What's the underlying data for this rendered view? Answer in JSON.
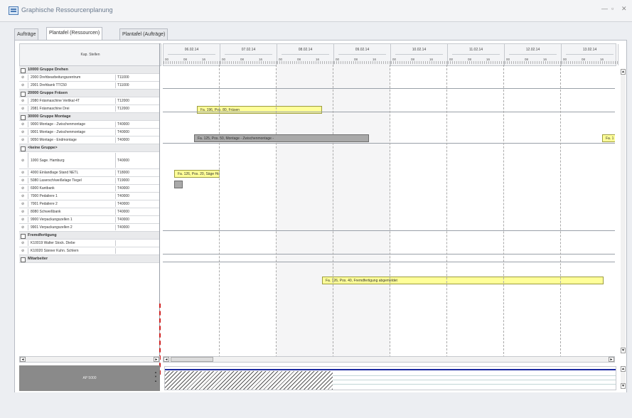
{
  "window": {
    "title": "Graphische Ressourcenplanung",
    "controls": [
      "—",
      "▫",
      "✕"
    ]
  },
  "tabs": [
    {
      "label": "Aufträge",
      "active": false
    },
    {
      "label": "Plantafel (Ressourcen)",
      "active": true
    },
    {
      "label": "Plantafel (Aufträge)",
      "active": false
    }
  ],
  "left_panel": {
    "header": "Kap. Stellen"
  },
  "groups": [
    {
      "label": "10000 Gruppe Drehen",
      "rows": [
        {
          "name": "2000 Drehbearbeitungszentrum",
          "code": "T11000"
        },
        {
          "name": "2001 Drehbank TTC50",
          "code": "T11000"
        }
      ]
    },
    {
      "label": "20000 Gruppe Fräsen",
      "rows": [
        {
          "name": "2080 Fräsmaschine Vertikal 4T",
          "code": "T12000"
        },
        {
          "name": "2081 Fräsmaschine Drei",
          "code": "T12000"
        }
      ]
    },
    {
      "label": "30000 Gruppe Montage",
      "rows": [
        {
          "name": "9000 Montage - Zwischenmontage",
          "code": "T40000"
        },
        {
          "name": "9001 Montage - Zwischenmontage",
          "code": "T40000"
        },
        {
          "name": "9050 Montage - Endmontage",
          "code": "T40000"
        }
      ]
    },
    {
      "label": "<keine Gruppe>",
      "rows": [
        {
          "name": "1000 Sage. Hamburg",
          "code": "T40000"
        },
        {
          "name": "4000 Einlandlage Stand NETL",
          "code": "T18000"
        },
        {
          "name": "5080 Lasersch/weißelage Tiegel",
          "code": "T19000"
        },
        {
          "name": "6900 Kantbank",
          "code": "T40000"
        },
        {
          "name": "7000 Pedaliere 1",
          "code": "T40000"
        },
        {
          "name": "7001 Pedaliere 2",
          "code": "T40000"
        },
        {
          "name": "8080 Schweißbank",
          "code": "T40000"
        },
        {
          "name": "9900 Verpackungszellen 1",
          "code": "T40000"
        },
        {
          "name": "9901 Verpackungszellen 2",
          "code": "T40000"
        }
      ]
    },
    {
      "label": "Fremdfertigung",
      "rows": [
        {
          "name": "K10019 Walter Stock. Diebe",
          "code": ""
        },
        {
          "name": "K10020 Sänner Kuhn. Schlern",
          "code": ""
        }
      ]
    },
    {
      "label": "Mitarbeiter",
      "rows": []
    }
  ],
  "timeline": {
    "days": [
      "06.02.14",
      "07.02.14",
      "08.02.14",
      "09.02.14",
      "10.02.14",
      "11.02.14",
      "12.02.14",
      "13.02.14"
    ],
    "hour_labels": [
      "00",
      "08",
      "16"
    ]
  },
  "bars": [
    {
      "label": "Fa. 196, Pos. 80, Fräsen",
      "color": "yellow"
    },
    {
      "label": "Fa. 125, Pos. 50, Montage - Zwischenmontage - ",
      "color": "gray"
    },
    {
      "label": "Fa. 1",
      "color": "yellow"
    },
    {
      "label": "Fa. 126, Pos. 20, Säge Hol",
      "color": "yellow"
    },
    {
      "label": "Fa. 126, Pos. 40, Fremdfertigung abgemeldet",
      "color": "yellow"
    }
  ],
  "capacity": {
    "label": "AP 5000"
  },
  "scroll": {
    "up": "▲",
    "down": "▼",
    "left": "◄",
    "right": "►"
  }
}
